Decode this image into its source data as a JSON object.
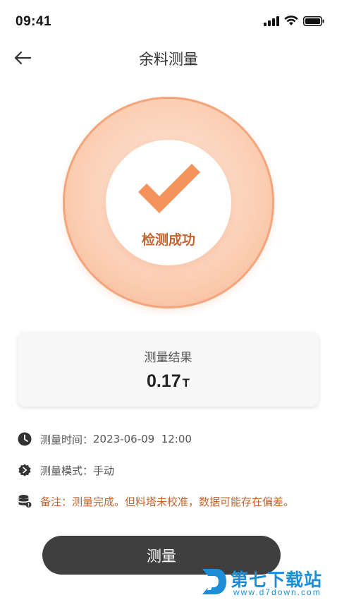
{
  "status_bar": {
    "time": "09:41"
  },
  "header": {
    "title": "余料测量"
  },
  "result_ring": {
    "status_text": "检测成功"
  },
  "result_card": {
    "label": "测量结果",
    "value": "0.17",
    "unit": "T"
  },
  "info": {
    "time_label": "测量时间：",
    "time_value": "2023-06-09  12:00",
    "mode_label": "测量模式：",
    "mode_value": "手动",
    "note_label": "备注：",
    "note_value": "测量完成。但料塔未校准，数据可能存在偏差。"
  },
  "actions": {
    "measure_label": "测量"
  },
  "watermark": {
    "title": "第七下载站",
    "url": "www.d7down.com"
  },
  "colors": {
    "accent": "#c4652e",
    "ring": "#f6b08c",
    "button": "#3f3f3f",
    "watermark": "#1c8ed8"
  },
  "icons": {
    "back": "arrow-left-icon",
    "clock": "clock-icon",
    "mode": "gear-icon",
    "note": "database-icon",
    "check": "check-icon"
  }
}
